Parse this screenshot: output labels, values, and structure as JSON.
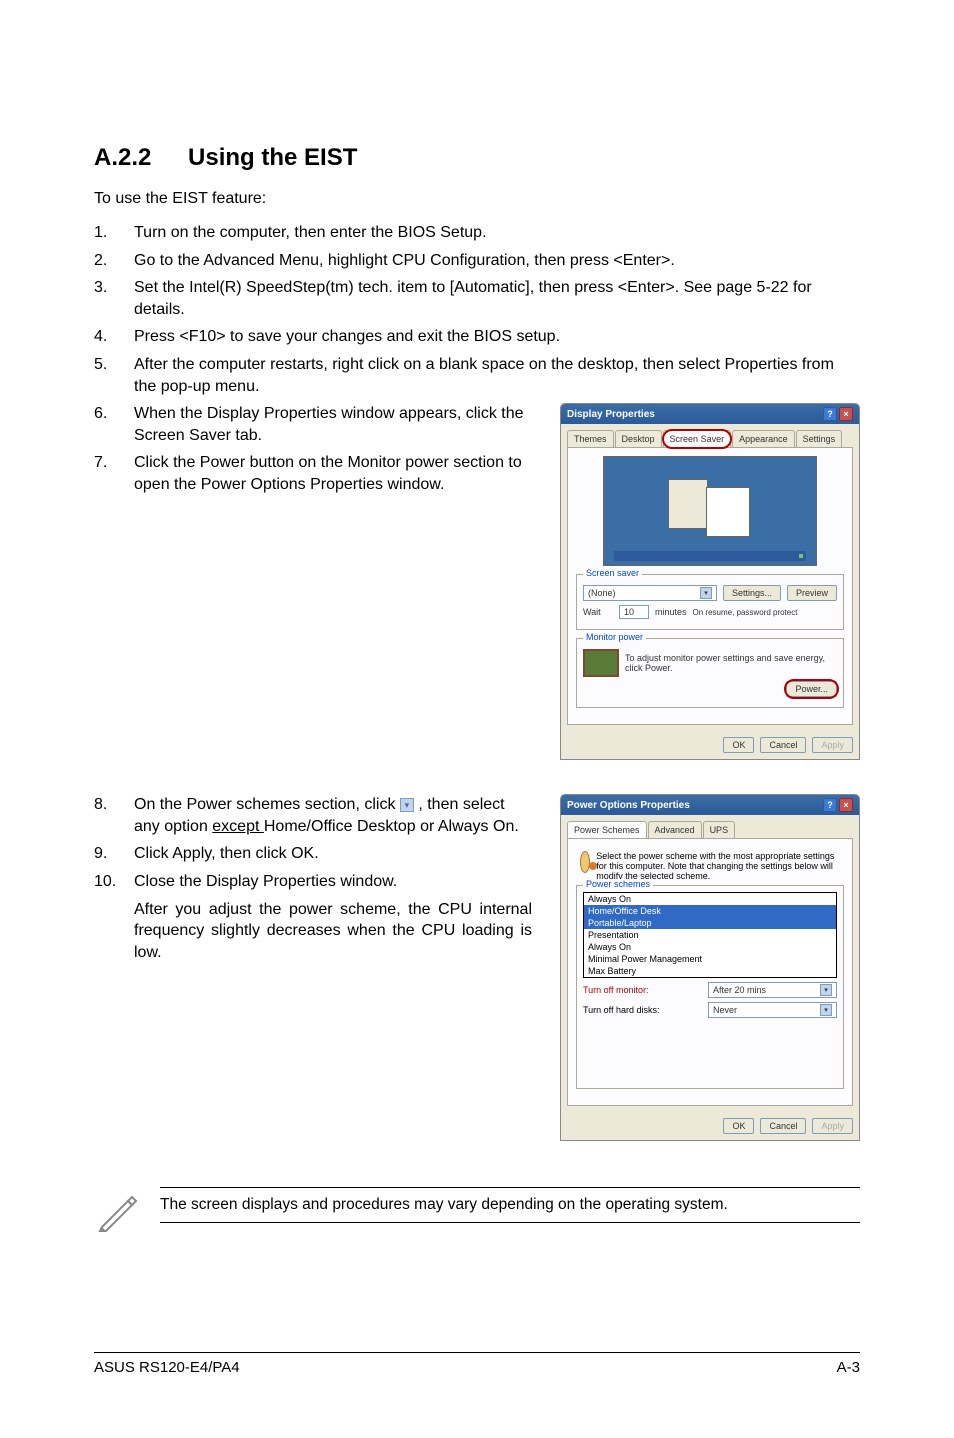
{
  "heading": {
    "number": "A.2.2",
    "title": "Using the EIST"
  },
  "intro": "To use the EIST feature:",
  "steps": [
    {
      "n": "1.",
      "t": "Turn on the computer, then enter the BIOS Setup."
    },
    {
      "n": "2.",
      "t": "Go to the Advanced Menu, highlight CPU Configuration, then press <Enter>."
    },
    {
      "n": "3.",
      "t": "Set the Intel(R) SpeedStep(tm) tech. item to [Automatic], then press <Enter>. See page 5-22 for details."
    },
    {
      "n": "4.",
      "t": "Press <F10> to save your changes and exit the BIOS setup."
    },
    {
      "n": "5.",
      "t": "After the computer restarts, right click on a blank space on the desktop, then select Properties from the pop-up menu."
    },
    {
      "n": "6.",
      "t": "When the Display Properties window appears, click the Screen Saver tab."
    },
    {
      "n": "7.",
      "t": "Click the Power button on the Monitor power section to open the Power Options Properties window."
    }
  ],
  "steps2": [
    {
      "n": "8.",
      "pre": "On the Power schemes section, click ",
      "post": " , then select any option ",
      "u": "except ",
      "tail": "Home/Office Desktop or Always On."
    },
    {
      "n": "9.",
      "t": "Click Apply, then click OK."
    },
    {
      "n": "10.",
      "t": "Close the Display Properties window.",
      "extra": "After you adjust the power scheme, the CPU internal frequency slightly decreases when the CPU loading is low."
    }
  ],
  "note": "The screen displays and procedures may vary depending on the operating system.",
  "footer": {
    "left": "ASUS RS120-E4/PA4",
    "right": "A-3"
  },
  "displayProps": {
    "title": "Display Properties",
    "tabs": [
      "Themes",
      "Desktop",
      "Screen Saver",
      "Appearance",
      "Settings"
    ],
    "screenSaverGroup": "Screen saver",
    "screenSaverDD": "(None)",
    "settingsBtn": "Settings...",
    "previewBtn": "Preview",
    "waitLabel": "Wait",
    "waitVal": "10",
    "waitMin": "minutes",
    "resumeChk": "On resume, password protect",
    "monitorGroup": "Monitor power",
    "monitorText": "To adjust monitor power settings and save energy, click Power.",
    "powerBtn": "Power...",
    "ok": "OK",
    "cancel": "Cancel",
    "apply": "Apply"
  },
  "powerOptions": {
    "title": "Power Options Properties",
    "tabs": [
      "Power Schemes",
      "Advanced",
      "UPS"
    ],
    "headerText": "Select the power scheme with the most appropriate settings for this computer. Note that changing the settings below will modify the selected scheme.",
    "powerSchemesGroup": "Power schemes",
    "ddSelected": "Home/Office Desk",
    "ddOptions": [
      "Always On",
      "Home/Office Desk",
      "Portable/Laptop",
      "Presentation",
      "Always On",
      "Minimal Power Management",
      "Max Battery"
    ],
    "turnOffMonitorLabel": "Turn off monitor:",
    "turnOffMonitorVal": "After 20 mins",
    "turnOffHDLabel": "Turn off hard disks:",
    "turnOffHDVal": "Never",
    "ok": "OK",
    "cancel": "Cancel",
    "apply": "Apply"
  }
}
